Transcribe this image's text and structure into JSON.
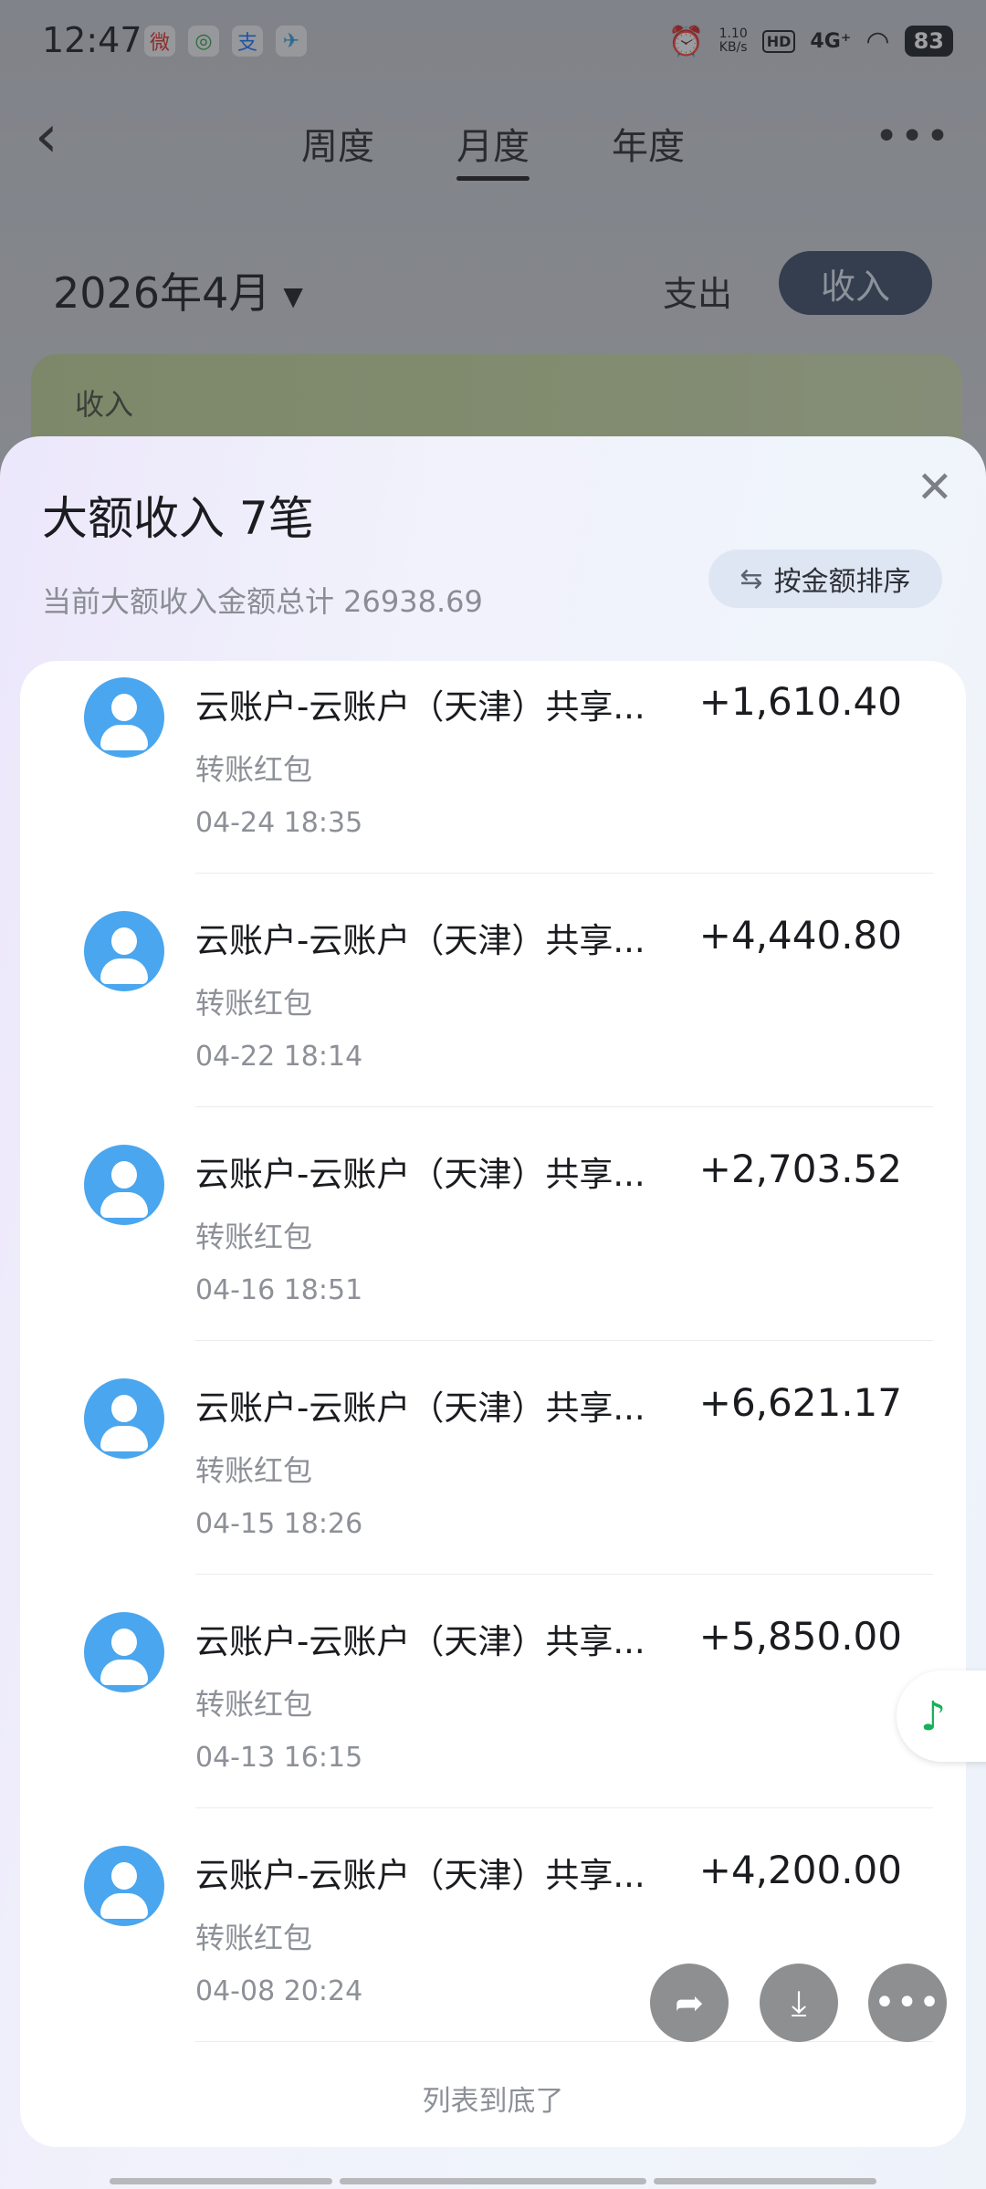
{
  "status_bar": {
    "time": "12:47",
    "apps": [
      "微",
      "◎",
      "支",
      "✈"
    ],
    "net_speed_value": "1.10",
    "net_speed_unit": "KB/s",
    "hd": "HD",
    "signal": "4G⁺",
    "battery": "83"
  },
  "nav": {
    "tabs": [
      {
        "label": "周度"
      },
      {
        "label": "月度"
      },
      {
        "label": "年度"
      }
    ],
    "active_tab": "月度"
  },
  "period": {
    "month": "2026年4月",
    "expense_label": "支出",
    "income_label": "收入"
  },
  "background_card": {
    "title": "收入"
  },
  "sheet": {
    "title": "大额收入 7笔",
    "subtitle": "当前大额收入金额总计 26938.69",
    "sort_label": "按金额排序",
    "rows": [
      {
        "name": "云账户-云账户（天津）共享...",
        "amount": "+1,610.40",
        "type": "转账红包",
        "time": "04-24 18:35"
      },
      {
        "name": "云账户-云账户（天津）共享...",
        "amount": "+4,440.80",
        "type": "转账红包",
        "time": "04-22 18:14"
      },
      {
        "name": "云账户-云账户（天津）共享...",
        "amount": "+2,703.52",
        "type": "转账红包",
        "time": "04-16 18:51"
      },
      {
        "name": "云账户-云账户（天津）共享...",
        "amount": "+6,621.17",
        "type": "转账红包",
        "time": "04-15 18:26"
      },
      {
        "name": "云账户-云账户（天津）共享...",
        "amount": "+5,850.00",
        "type": "转账红包",
        "time": "04-13 16:15"
      },
      {
        "name": "云账户-云账户（天津）共享...",
        "amount": "+4,200.00",
        "type": "转账红包",
        "time": "04-08 20:24"
      }
    ],
    "end_text": "列表到底了"
  },
  "colors": {
    "accent_pill": "#3f4f66",
    "avatar": "#4aa6ee",
    "music": "#14b15a"
  }
}
